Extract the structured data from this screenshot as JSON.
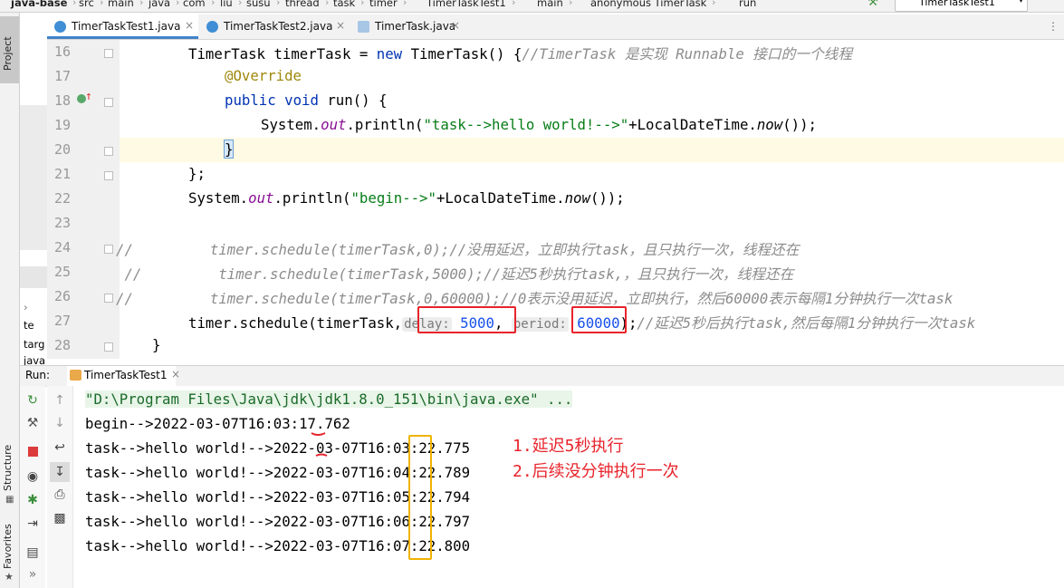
{
  "breadcrumb": [
    "java-base",
    "src",
    "main",
    "java",
    "com",
    "liu",
    "susu",
    "thread",
    "task",
    "timer",
    "TimerTaskTest1",
    "main",
    "anonymous TimerTask",
    "run"
  ],
  "run_config": "TimerTaskTest1",
  "left_stripe": {
    "project": "Project",
    "structure": "Structure",
    "favorites": "Favorites"
  },
  "project_peek": [
    "te",
    "targ",
    "java"
  ],
  "tabs": [
    {
      "label": "TimerTaskTest1.java",
      "active": true
    },
    {
      "label": "TimerTaskTest2.java",
      "active": false
    },
    {
      "label": "TimerTask.java",
      "active": false
    }
  ],
  "code": {
    "l16": {
      "n": "16",
      "a": "TimerTask timerTask = ",
      "kw": "new",
      "b": " TimerTask() {",
      "c": "//TimerTask 是实现 Runnable 接口的一个线程"
    },
    "l17": {
      "n": "17",
      "ann": "@Override"
    },
    "l18": {
      "n": "18",
      "kw1": "public",
      "kw2": "void",
      "b": " run() {"
    },
    "l19": {
      "n": "19",
      "a": "System.",
      "f": "out",
      "b": ".println(",
      "s": "\"task-->hello world!-->\"",
      "c": "+LocalDateTime.",
      "m": "now",
      "d": "());"
    },
    "l20": {
      "n": "20",
      "a": "}"
    },
    "l21": {
      "n": "21",
      "a": "};"
    },
    "l22": {
      "n": "22",
      "a": "System.",
      "f": "out",
      "b": ".println(",
      "s": "\"begin-->\"",
      "c": "+LocalDateTime.",
      "m": "now",
      "d": "());"
    },
    "l23": {
      "n": "23"
    },
    "l24": {
      "n": "24",
      "c": "//         timer.schedule(timerTask,0);//没用延迟，立即执行task，且只执行一次，线程还在"
    },
    "l25": {
      "n": "25",
      "c": " //         timer.schedule(timerTask,5000);//延迟5秒执行task,，且只执行一次，线程还在"
    },
    "l26": {
      "n": "26",
      "c": "//         timer.schedule(timerTask,0,60000);//0表示没用延迟，立即执行，然后60000表示每隔1分钟执行一次task"
    },
    "l27": {
      "n": "27",
      "a": "timer.schedule(timerTask,",
      "h1": "delay:",
      "v1": "5000",
      "h2": "period:",
      "v2": "60000",
      "b": ");",
      "c": "//延迟5秒后执行task,然后每隔1分钟执行一次task"
    },
    "l28": {
      "n": "28",
      "a": "}"
    }
  },
  "run": {
    "label": "Run:",
    "tab": "TimerTaskTest1",
    "console": [
      "\"D:\\Program Files\\Java\\jdk\\jdk1.8.0_151\\bin\\java.exe\" ...",
      "begin-->2022-03-07T16:03:17.762",
      "task-->hello world!-->2022-03-07T16:03:22.775",
      "task-->hello world!-->2022-03-07T16:04:22.789",
      "task-->hello world!-->2022-03-07T16:05:22.794",
      "task-->hello world!-->2022-03-07T16:06:22.797",
      "task-->hello world!-->2022-03-07T16:07:22.800"
    ],
    "notes": [
      "1.延迟5秒执行",
      "2.后续没分钟执行一次"
    ]
  },
  "colors": {
    "annotation_red": "#e8232b",
    "annotation_yellow": "#f0b400",
    "keyword": "#0033b3",
    "string": "#067d17"
  }
}
